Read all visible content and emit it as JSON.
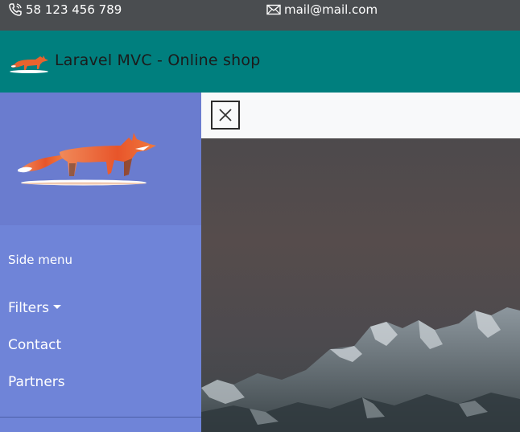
{
  "topbar": {
    "phone": "58 123 456 789",
    "email": "mail@mail.com",
    "phone_icon": "phone-icon",
    "mail_icon": "mail-icon"
  },
  "header": {
    "title": "Laravel MVC - Online shop",
    "logo_icon": "fox-logo-icon"
  },
  "sidebar": {
    "heading": "Side menu",
    "items": [
      {
        "label": "Filters",
        "has_dropdown": true
      },
      {
        "label": "Contact"
      },
      {
        "label": "Partners"
      }
    ]
  },
  "main": {
    "close_icon": "close-icon",
    "hero_image": "snowy-mountain-range"
  },
  "colors": {
    "topbar_bg": "#4a4d50",
    "header_bg": "#007f7e",
    "sidebar_bg": "#6f84d8",
    "main_topbar_bg": "#f8f9fa"
  }
}
